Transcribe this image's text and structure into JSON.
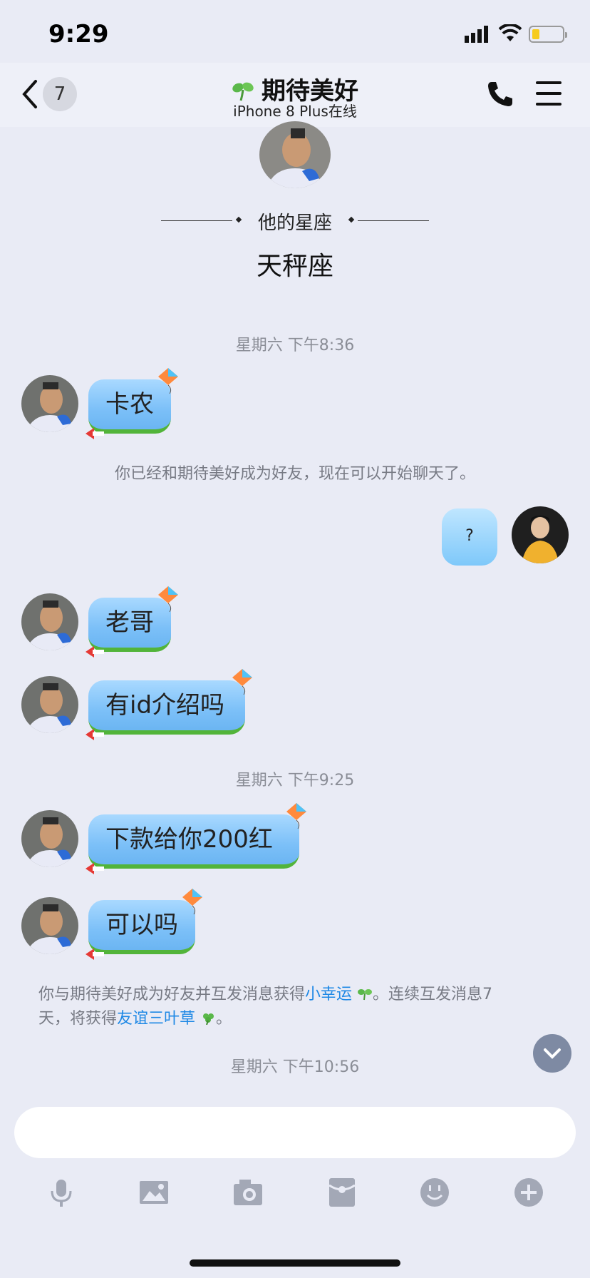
{
  "status_bar": {
    "time": "9:29"
  },
  "header": {
    "back_badge": "7",
    "title": "期待美好",
    "subtitle": "iPhone 8 Plus在线"
  },
  "profile": {
    "zodiac_label": "他的星座",
    "zodiac_value": "天秤座"
  },
  "messages": {
    "time1": "星期六 下午8:36",
    "msg1": "卡农",
    "sys1": "你已经和期待美好成为好友，现在可以开始聊天了。",
    "sent1": "?",
    "msg2": "老哥",
    "msg3": "有id介绍吗",
    "time2": "星期六 下午9:25",
    "msg4": "下款给你200红",
    "msg5": "可以吗",
    "sys2_a": "你与期待美好成为好友并互发消息获得",
    "sys2_link1": "小幸运",
    "sys2_b": "。连续互发消息7",
    "sys2_c": "天，将获得",
    "sys2_link2": "友谊三叶草",
    "sys2_d": "。",
    "time3": "星期六 下午10:56"
  },
  "input": {
    "placeholder": ""
  },
  "colors": {
    "link": "#1e88e5",
    "bubble": "#7cc0f8",
    "grass": "#52b43a"
  }
}
